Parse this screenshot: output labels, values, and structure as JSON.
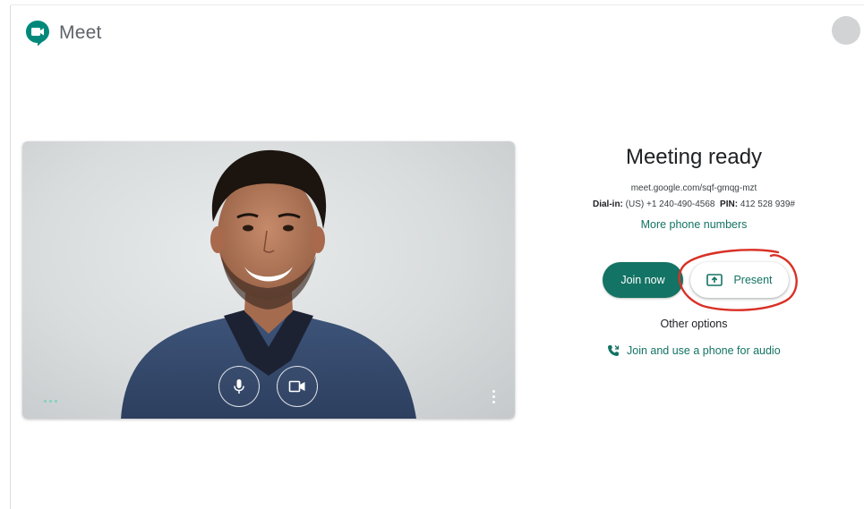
{
  "app": {
    "title": "Meet",
    "brand_color": "#00897b",
    "accent_color": "#137364"
  },
  "header": {
    "logo_icon": "meet-logo-icon",
    "avatar_icon": "avatar"
  },
  "preview": {
    "mic_icon": "microphone-icon",
    "camera_icon": "camera-icon",
    "more_icon": "more-vertical-icon"
  },
  "meeting": {
    "title": "Meeting ready",
    "url": "meet.google.com/sqf-gmqg-mzt",
    "dialin_label": "Dial-in:",
    "dialin_number": "(US) +1 240-490-4568",
    "pin_label": "PIN:",
    "pin_value": "412 528 939#",
    "more_phones": "More phone numbers"
  },
  "actions": {
    "join_label": "Join now",
    "present_label": "Present",
    "present_icon": "present-screen-icon",
    "other_options": "Other options",
    "phone_audio_label": "Join and use a phone for audio",
    "phone_audio_icon": "phone-icon",
    "highlight_color": "#d93025"
  }
}
